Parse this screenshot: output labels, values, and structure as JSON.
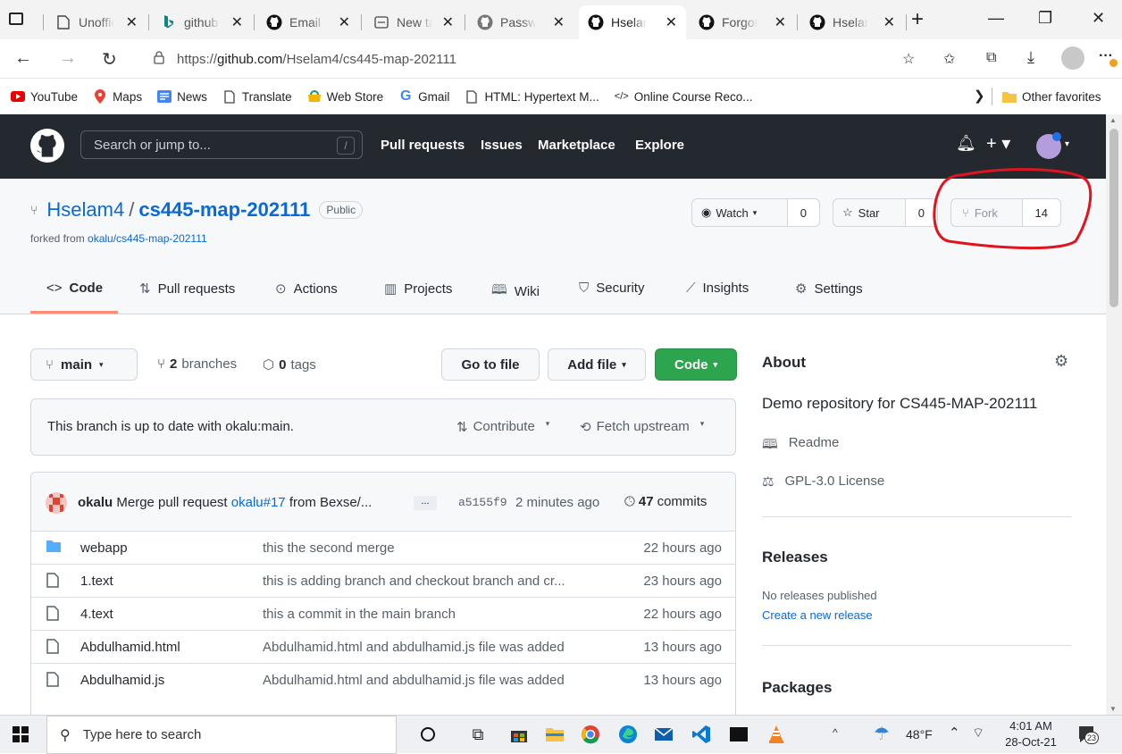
{
  "browser": {
    "tabs": [
      {
        "title": "Unoffic",
        "icon": "document-icon"
      },
      {
        "title": "github",
        "icon": "bing-icon"
      },
      {
        "title": "Email s",
        "icon": "github-icon"
      },
      {
        "title": "New ta",
        "icon": "newtab-icon"
      },
      {
        "title": "Passwo",
        "icon": "github-icon"
      },
      {
        "title": "Hselam",
        "icon": "github-icon"
      },
      {
        "title": "Forgot",
        "icon": "github-icon"
      },
      {
        "title": "Hselam",
        "icon": "github-icon"
      }
    ],
    "url_prefix": "https://",
    "url_domain": "github.com",
    "url_path": "/Hselam4/cs445-map-202111",
    "favorites": [
      "YouTube",
      "Maps",
      "News",
      "Translate",
      "Web Store",
      "Gmail",
      "HTML: Hypertext M...",
      "Online Course Reco..."
    ],
    "other_favorites": "Other favorites"
  },
  "github": {
    "search_placeholder": "Search or jump to...",
    "slash": "/",
    "nav": [
      "Pull requests",
      "Issues",
      "Marketplace",
      "Explore"
    ]
  },
  "repo": {
    "owner": "Hselam4",
    "separator": "/",
    "name": "cs445-map-202111",
    "visibility": "Public",
    "forked_prefix": "forked from ",
    "forked_from": "okalu/cs445-map-202111",
    "watch_label": "Watch",
    "watch_count": "0",
    "star_label": "Star",
    "star_count": "0",
    "fork_label": "Fork",
    "fork_count": "14",
    "tabs": [
      "Code",
      "Pull requests",
      "Actions",
      "Projects",
      "Wiki",
      "Security",
      "Insights",
      "Settings"
    ]
  },
  "main": {
    "branch": "main",
    "branches_count": "2",
    "branches_label": "branches",
    "tags_count": "0",
    "tags_label": "tags",
    "go_to_file": "Go to file",
    "add_file": "Add file",
    "code": "Code",
    "status_text": "This branch is up to date with okalu:main.",
    "contribute": "Contribute",
    "fetch_upstream": "Fetch upstream",
    "commit_author": "okalu",
    "commit_msg_pre": "Merge pull request ",
    "commit_link": "okalu#17",
    "commit_msg_post": " from Bexse/...",
    "commit_more": "...",
    "commit_hash": "a5155f9",
    "commit_time": "2 minutes ago",
    "commits_count": "47",
    "commits_label": "commits",
    "files": [
      {
        "name": "webapp",
        "message": "this the second merge",
        "time": "22 hours ago",
        "type": "folder"
      },
      {
        "name": "1.text",
        "message": "this is adding branch and checkout branch and cr...",
        "time": "23 hours ago",
        "type": "file"
      },
      {
        "name": "4.text",
        "message": "this a commit in the main branch",
        "time": "22 hours ago",
        "type": "file"
      },
      {
        "name": "Abdulhamid.html",
        "message": "Abdulhamid.html and abdulhamid.js file was added",
        "time": "13 hours ago",
        "type": "file"
      },
      {
        "name": "Abdulhamid.js",
        "message": "Abdulhamid.html and abdulhamid.js file was added",
        "time": "13 hours ago",
        "type": "file"
      }
    ]
  },
  "sidebar": {
    "about_title": "About",
    "description": "Demo repository for CS445-MAP-202111",
    "readme": "Readme",
    "license": "GPL-3.0 License",
    "releases_title": "Releases",
    "no_releases": "No releases published",
    "create_release": "Create a new release",
    "packages_title": "Packages"
  },
  "taskbar": {
    "search_placeholder": "Type here to search",
    "weather": "48°F",
    "time": "4:01 AM",
    "date": "28-Oct-21",
    "notifications": "23"
  },
  "colors": {
    "annotation": "#e0141e",
    "code_button": "#2da44e",
    "link": "#0969da",
    "header": "#24292f"
  }
}
